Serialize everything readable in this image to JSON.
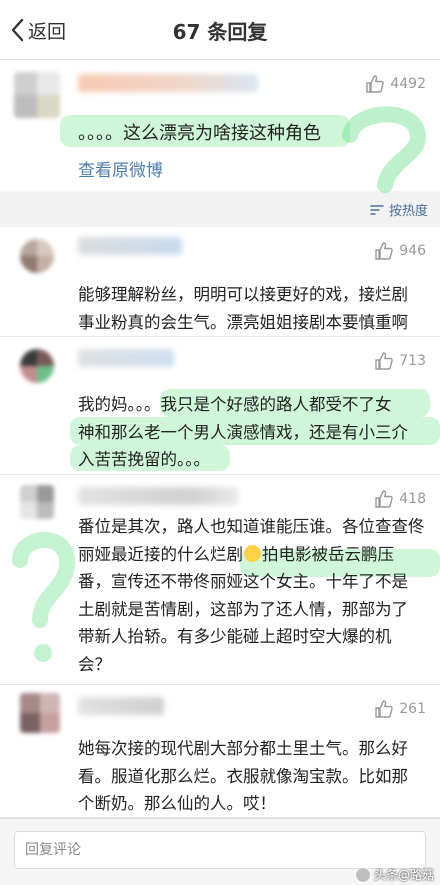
{
  "header": {
    "back_label": "返回",
    "title": "67 条回复"
  },
  "post": {
    "likes": "4492",
    "text": "。。。。这么漂亮为啥接这种角色",
    "view_weibo": "查看原微博"
  },
  "sort": {
    "label": "按热度"
  },
  "comments": [
    {
      "likes": "946",
      "lines": [
        "能够理解粉丝，明明可以接更好的戏，接烂剧",
        "事业粉真的会生气。漂亮姐姐接剧本要慎重啊"
      ]
    },
    {
      "likes": "713",
      "lines": [
        "我的妈。。。我只是个好感的路人都受不了女",
        "神和那么老一个男人演感情戏，还是有小三介",
        "入苦苦挽留的。。。"
      ]
    },
    {
      "likes": "418",
      "lines": [
        "番位是其次，路人也知道谁能压谁。各位查查佟",
        "丽娅最近接的什么烂剧",
        "拍电影被岳云鹏压",
        "番，宣传还不带佟丽娅这个女主。十年了不是",
        "土剧就是苦情剧，这部为了还人情，那部为了",
        "带新人抬轿。有多少能碰上超时空大爆的机",
        "会？"
      ]
    },
    {
      "likes": "261",
      "lines": [
        "她每次接的现代剧大部分都土里土气。那么好",
        "看。服道化那么烂。衣服就像淘宝款。比如那",
        "个断奶。那么仙的人。哎！"
      ]
    }
  ],
  "footer": {
    "reply_placeholder": "回复评论",
    "watermark": "头条@路菇"
  },
  "colors": {
    "link": "#507daf",
    "highlight": "#7de696",
    "like_gray": "#999999"
  }
}
